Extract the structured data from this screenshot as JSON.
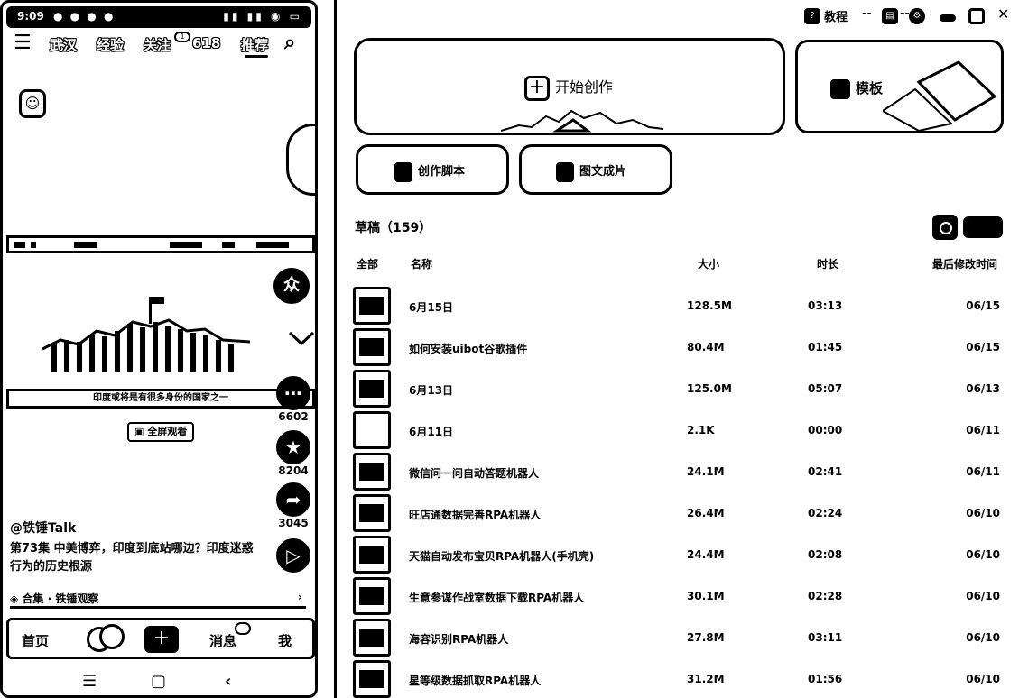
{
  "phone": {
    "status": {
      "time": "9:09"
    },
    "nav": {
      "tabs": [
        "武汉",
        "经验",
        "关注",
        "618",
        "推荐"
      ],
      "follow_badge": "1"
    },
    "video": {
      "caption": "印度或将是有很多身份的国家之一",
      "fullscreen_label": "全屏观看"
    },
    "actions": {
      "comments": "6602",
      "favorites": "8204",
      "shares": "3045"
    },
    "author": "@铁锤Talk",
    "episode_title": "第73集 中美博弈，印度到底站哪边？印度迷惑行为的历史根源",
    "collection": "合集 · 铁锤观察",
    "tabs": [
      "首页",
      "消息",
      "我"
    ]
  },
  "app": {
    "titlebar": {
      "tutorial": "教程"
    },
    "create_label": "开始创作",
    "template_label": "模板",
    "script_label": "创作脚本",
    "image_video_label": "图文成片",
    "drafts_label": "草稿（159）",
    "columns": {
      "all": "全部",
      "name": "名称",
      "size": "大小",
      "duration": "时长",
      "modified": "最后修改时间"
    },
    "rows": [
      {
        "name": "6月15日",
        "size": "128.5M",
        "duration": "03:13",
        "date": "06/15"
      },
      {
        "name": "如何安装uibot谷歌插件",
        "size": "80.4M",
        "duration": "01:45",
        "date": "06/15"
      },
      {
        "name": "6月13日",
        "size": "125.0M",
        "duration": "05:07",
        "date": "06/13"
      },
      {
        "name": "6月11日",
        "size": "2.1K",
        "duration": "00:00",
        "date": "06/11"
      },
      {
        "name": "微信问一问自动答题机器人",
        "size": "24.1M",
        "duration": "02:41",
        "date": "06/11"
      },
      {
        "name": "旺店通数据完善RPA机器人",
        "size": "26.4M",
        "duration": "02:24",
        "date": "06/10"
      },
      {
        "name": "天猫自动发布宝贝RPA机器人(手机壳)",
        "size": "24.4M",
        "duration": "02:08",
        "date": "06/10"
      },
      {
        "name": "生意参谋作战室数据下载RPA机器人",
        "size": "30.1M",
        "duration": "02:28",
        "date": "06/10"
      },
      {
        "name": "海容识别RPA机器人",
        "size": "27.8M",
        "duration": "03:11",
        "date": "06/10"
      },
      {
        "name": "星等级数据抓取RPA机器人",
        "size": "31.2M",
        "duration": "01:56",
        "date": "06/10"
      }
    ]
  }
}
